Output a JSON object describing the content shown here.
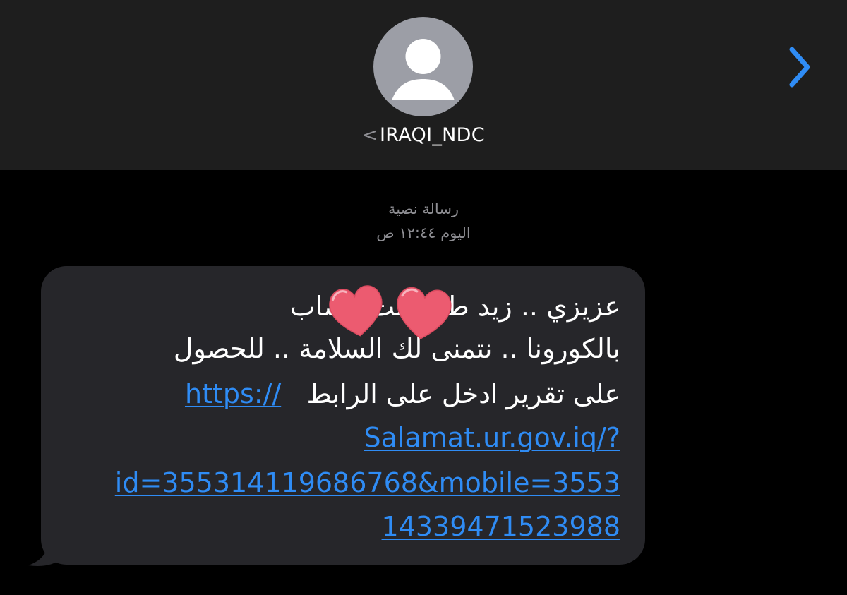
{
  "header": {
    "contact_name": "IRAQI_NDC",
    "back_chevron": "<",
    "info_icon": "chevron-right-icon",
    "avatar_icon": "person-silhouette-icon"
  },
  "conversation": {
    "message_type": "رسالة نصية",
    "timestamp": "اليوم ١٢:٤٤ ص"
  },
  "message": {
    "line1": "عزيزي .. زيد ط م انت مصاب",
    "line2": "بالكورونا .. نتمنى لك السلامة .. للحصول",
    "line3_text": "على تقرير ادخل على الرابط",
    "line3_link": "https://",
    "line4_link": "Salamat.ur.gov.iq/?",
    "line5_link": "id=355314119686768&mobile=3553",
    "line6_link": "14339471523988",
    "redaction_icon": "heart-sticker-icon"
  },
  "colors": {
    "header_bg": "#1e1e1e",
    "bubble_bg": "#26262a",
    "link": "#2f8cf5",
    "meta_text": "#8e8e93",
    "avatar_bg": "#9c9ea6",
    "heart": "#ec5b70"
  }
}
